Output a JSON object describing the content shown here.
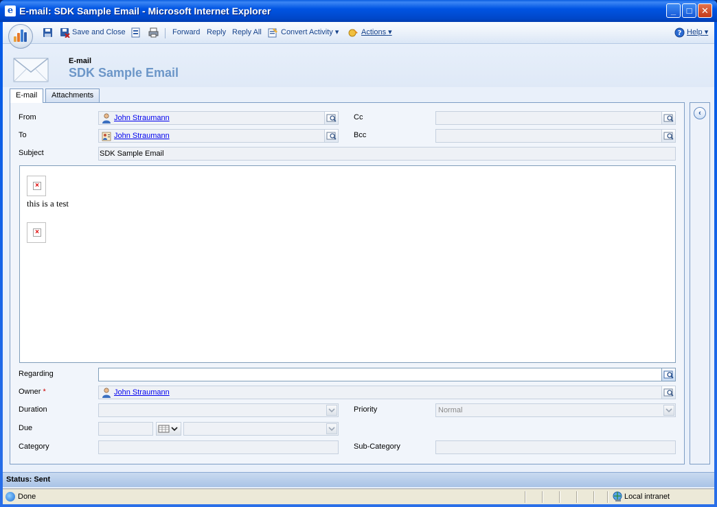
{
  "window": {
    "title": "E-mail: SDK Sample Email - Microsoft Internet Explorer",
    "min": "_",
    "max": "□",
    "close": "✕"
  },
  "toolbar": {
    "save_and_close": "Save and Close",
    "forward": "Forward",
    "reply": "Reply",
    "reply_all": "Reply All",
    "convert_activity": "Convert Activity",
    "actions": "Actions",
    "help": "Help",
    "dropdown_arrow": "▾"
  },
  "header": {
    "entity_type": "E-mail",
    "record_title": "SDK Sample Email"
  },
  "tabs": [
    {
      "label": "E-mail",
      "active": true
    },
    {
      "label": "Attachments",
      "active": false
    }
  ],
  "form": {
    "from": {
      "label": "From",
      "value": "John Straumann"
    },
    "to": {
      "label": "To",
      "value": "John Straumann"
    },
    "cc": {
      "label": "Cc",
      "value": ""
    },
    "bcc": {
      "label": "Bcc",
      "value": ""
    },
    "subject": {
      "label": "Subject",
      "value": "SDK Sample Email"
    },
    "body_text": "this is a test",
    "regarding": {
      "label": "Regarding",
      "value": ""
    },
    "owner": {
      "label": "Owner",
      "required_mark": "*",
      "value": "John Straumann"
    },
    "duration": {
      "label": "Duration",
      "value": ""
    },
    "priority": {
      "label": "Priority",
      "value": "Normal"
    },
    "due": {
      "label": "Due",
      "value": ""
    },
    "category": {
      "label": "Category",
      "value": ""
    },
    "sub_category": {
      "label": "Sub-Category",
      "value": ""
    }
  },
  "status": {
    "text": "Status: Sent"
  },
  "ie_status": {
    "done": "Done",
    "zone": "Local intranet"
  },
  "side_panel": {
    "collapse_glyph": "‹"
  },
  "image_placeholder_glyph": "×"
}
